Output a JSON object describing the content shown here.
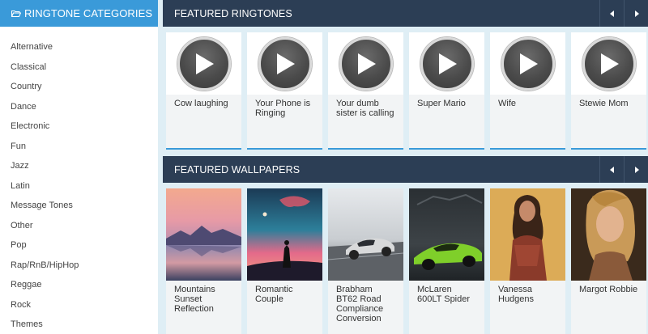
{
  "sidebar": {
    "header": "RINGTONE CATEGORIES",
    "header_icon": "folder-open-icon",
    "categories": [
      "Alternative",
      "Classical",
      "Country",
      "Dance",
      "Electronic",
      "Fun",
      "Jazz",
      "Latin",
      "Message Tones",
      "Other",
      "Pop",
      "Rap/RnB/HipHop",
      "Reggae",
      "Rock",
      "Themes"
    ]
  },
  "ringtones": {
    "title": "FEATURED RINGTONES",
    "prev_icon": "caret-left-icon",
    "next_icon": "caret-right-icon",
    "items": [
      {
        "name": "Cow laughing"
      },
      {
        "name": "Your Phone is Ringing"
      },
      {
        "name": "Your dumb sister is calling"
      },
      {
        "name": "Super Mario"
      },
      {
        "name": "Wife"
      },
      {
        "name": "Stewie Mom"
      }
    ]
  },
  "wallpapers": {
    "title": "FEATURED WALLPAPERS",
    "prev_icon": "caret-left-icon",
    "next_icon": "caret-right-icon",
    "items": [
      {
        "name": "Mountains Sunset Reflection"
      },
      {
        "name": "Romantic Couple"
      },
      {
        "name": "Brabham BT62 Road Compliance Conversion"
      },
      {
        "name": "McLaren 600LT Spider"
      },
      {
        "name": "Vanessa Hudgens"
      },
      {
        "name": "Margot Robbie"
      }
    ]
  },
  "colors": {
    "sidebar_header": "#3a9ad9",
    "section_bar": "#2c3e55",
    "page_bg": "#dfeef5",
    "accent": "#3a9ad9"
  }
}
